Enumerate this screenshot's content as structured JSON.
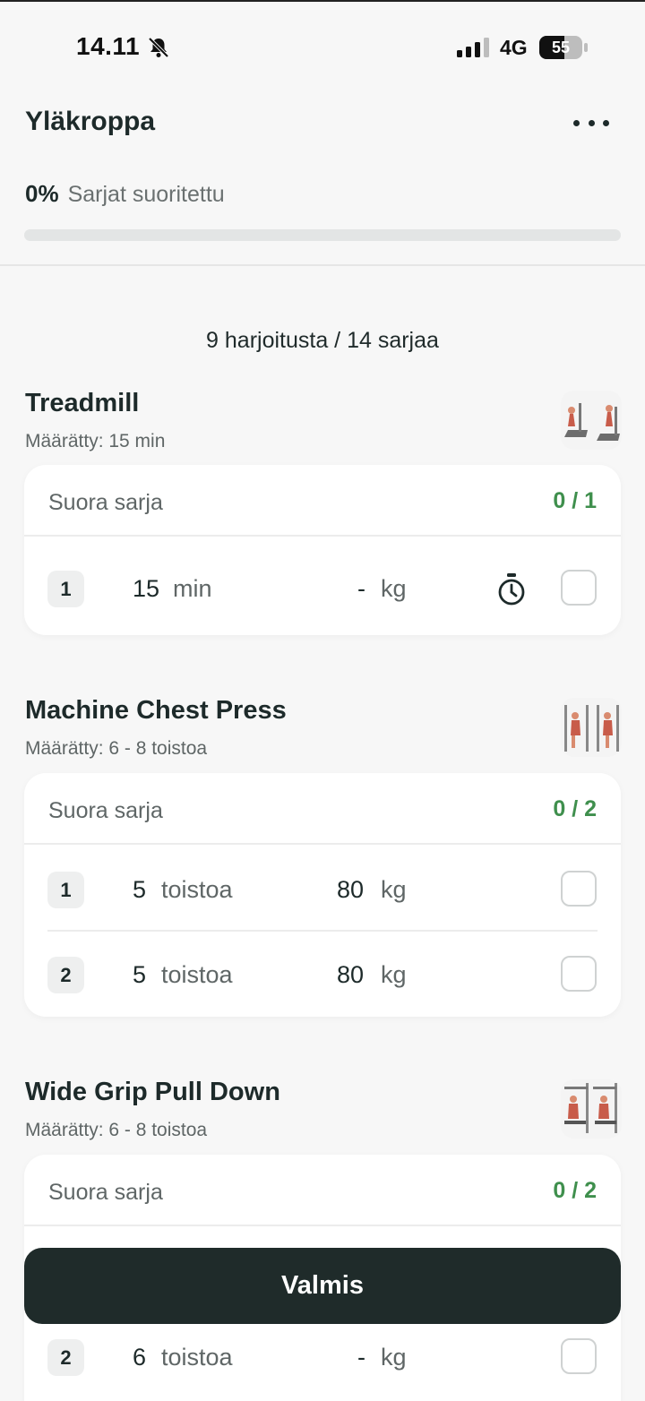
{
  "status_bar": {
    "time": "14.11",
    "network": "4G",
    "battery": "55",
    "icons": [
      "bell-muted-icon",
      "signal-icon",
      "battery-icon"
    ]
  },
  "header": {
    "title": "Yläkroppa",
    "more_icon": "more-horizontal-icon"
  },
  "progress": {
    "percent_label": "0%",
    "label": "Sarjat suoritettu",
    "fraction": 0
  },
  "summary": "9 harjoitusta / 14 sarjaa",
  "exercises": [
    {
      "name": "Treadmill",
      "assigned": "Määrätty: 15 min",
      "set_type": "Suora sarja",
      "count": "0 / 1",
      "sets": [
        {
          "num": "1",
          "value": "15",
          "value_unit": "min",
          "weight": "-",
          "weight_unit": "kg",
          "timer_icon": "stopwatch-icon"
        }
      ]
    },
    {
      "name": "Machine Chest Press",
      "assigned": "Määrätty: 6 - 8 toistoa",
      "set_type": "Suora sarja",
      "count": "0 / 2",
      "sets": [
        {
          "num": "1",
          "value": "5",
          "value_unit": "toistoa",
          "weight": "80",
          "weight_unit": "kg"
        },
        {
          "num": "2",
          "value": "5",
          "value_unit": "toistoa",
          "weight": "80",
          "weight_unit": "kg"
        }
      ]
    },
    {
      "name": "Wide Grip Pull Down",
      "assigned": "Määrätty: 6 - 8 toistoa",
      "set_type": "Suora sarja",
      "count": "0 / 2",
      "sets": [
        {
          "num": "2",
          "value": "6",
          "value_unit": "toistoa",
          "weight": "-",
          "weight_unit": "kg"
        }
      ]
    }
  ],
  "done_button": "Valmis",
  "colors": {
    "accent_green": "#3f8f4d",
    "dark_button": "#1f2b2a",
    "background": "#f7f7f7"
  }
}
